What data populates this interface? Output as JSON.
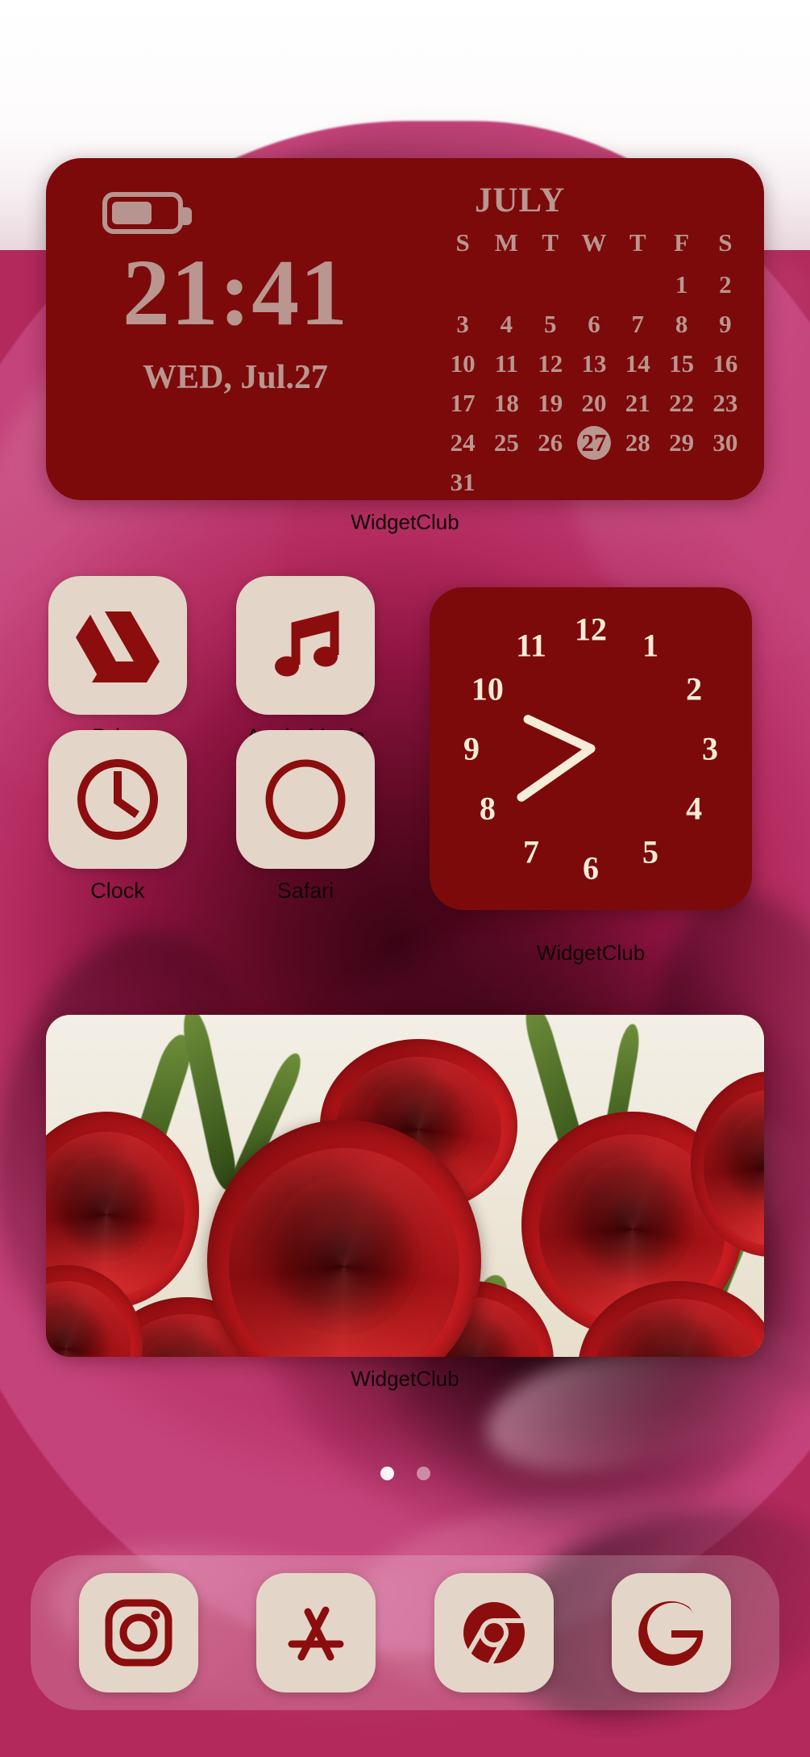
{
  "wallpaper": {
    "description": "red-rose-photo-wallpaper",
    "accent_dark_red": "#7c0a0a",
    "icon_tile_cream": "#e3d6c8",
    "widget_text_mauve": "#b9968f",
    "clock_numeral_ivory": "#f6ecd8"
  },
  "clock_widget": {
    "battery_icon": "battery-icon",
    "battery_level_percent": 56,
    "time": "21:41",
    "date": "WED, Jul.27",
    "caption": "WidgetClub"
  },
  "calendar_widget": {
    "month": "JULY",
    "day_headers": [
      "S",
      "M",
      "T",
      "W",
      "T",
      "F",
      "S"
    ],
    "leading_blanks": 5,
    "days": [
      1,
      2,
      3,
      4,
      5,
      6,
      7,
      8,
      9,
      10,
      11,
      12,
      13,
      14,
      15,
      16,
      17,
      18,
      19,
      20,
      21,
      22,
      23,
      24,
      25,
      26,
      27,
      28,
      29,
      30,
      31
    ],
    "today": 27
  },
  "apps": [
    {
      "label": "Drive",
      "icon": "google-drive-icon"
    },
    {
      "label": "Apple Music",
      "icon": "music-note-icon"
    },
    {
      "label": "Clock",
      "icon": "clock-icon"
    },
    {
      "label": "Safari",
      "icon": "compass-icon"
    }
  ],
  "analog_clock_widget": {
    "caption": "WidgetClub",
    "numerals": [
      "12",
      "1",
      "2",
      "3",
      "4",
      "5",
      "6",
      "7",
      "8",
      "9",
      "10",
      "11"
    ],
    "hour_hand_angle_deg": 295,
    "minute_hand_angle_deg": 235
  },
  "photo_widget": {
    "caption": "WidgetClub",
    "image_description": "bouquet of red roses"
  },
  "page_indicator": {
    "total_pages": 2,
    "current_page": 1
  },
  "dock": [
    {
      "label": "Instagram",
      "icon": "instagram-icon"
    },
    {
      "label": "App Store",
      "icon": "app-store-icon"
    },
    {
      "label": "Chrome",
      "icon": "chrome-icon"
    },
    {
      "label": "Google",
      "icon": "google-g-icon"
    }
  ]
}
